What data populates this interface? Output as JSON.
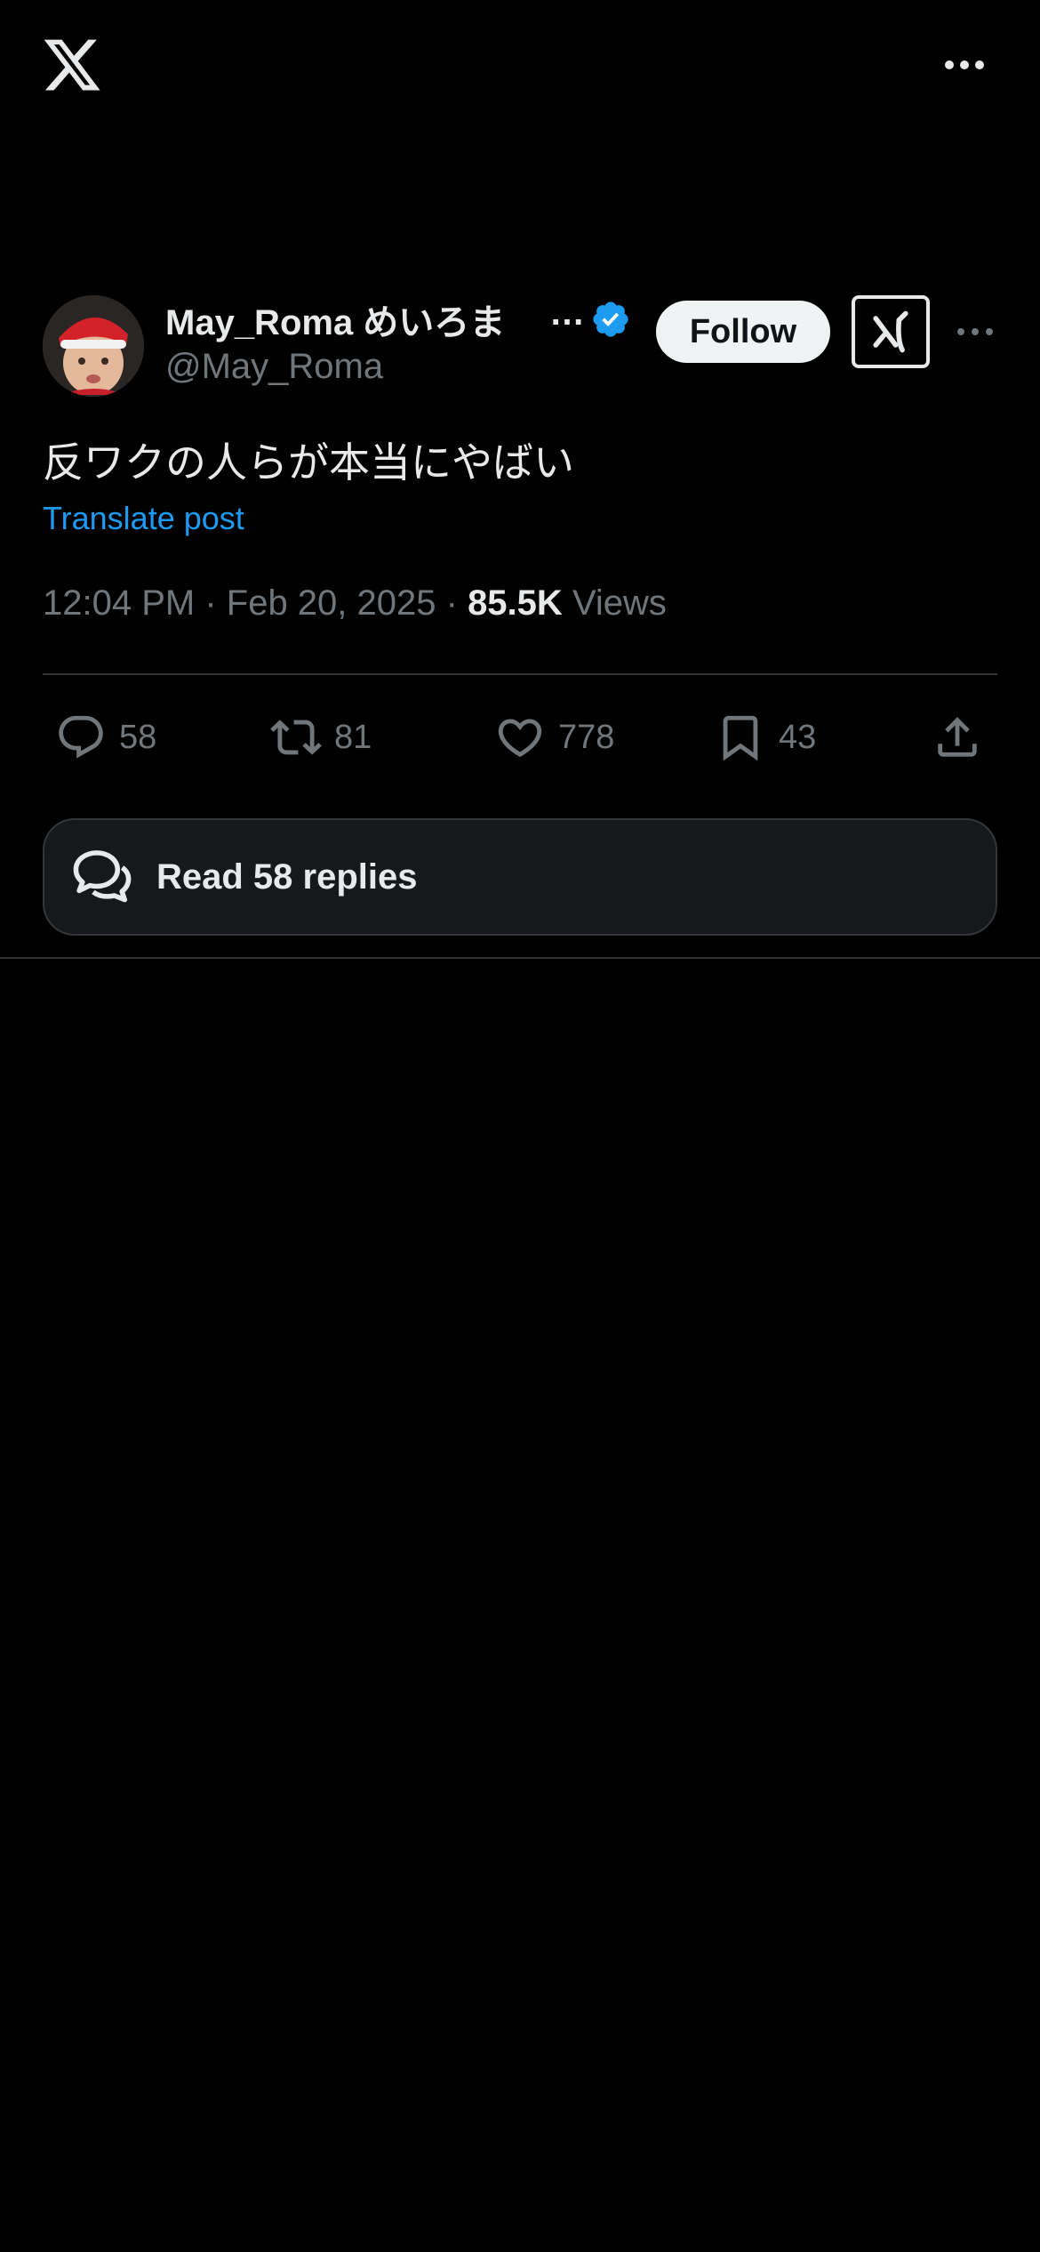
{
  "author": {
    "display_name": "May_Roma めいろま",
    "name_ellipsis": "…",
    "handle": "@May_Roma",
    "verified": true
  },
  "buttons": {
    "follow_label": "Follow"
  },
  "post": {
    "text": "反ワクの人らが本当にやばい",
    "translate_label": "Translate post",
    "timestamp": "12:04 PM · Feb 20, 2025 ·",
    "views_count": "85.5K",
    "views_label": "Views"
  },
  "actions": {
    "replies": "58",
    "reposts": "81",
    "likes": "778",
    "bookmarks": "43"
  },
  "read_replies_label": "Read 58 replies",
  "icons": {
    "logo": "x-logo-icon",
    "more": "more-horizontal-icon",
    "verified": "verified-badge-icon",
    "grok": "grok-icon",
    "reply": "reply-icon",
    "repost": "repost-icon",
    "like": "heart-icon",
    "bookmark": "bookmark-icon",
    "share": "share-icon",
    "replies": "chat-bubbles-icon"
  },
  "colors": {
    "background": "#000000",
    "text_primary": "#e7e9ea",
    "text_secondary": "#71767b",
    "accent": "#1d9bf0",
    "divider": "#2f3336",
    "follow_bg": "#eff3f4"
  }
}
